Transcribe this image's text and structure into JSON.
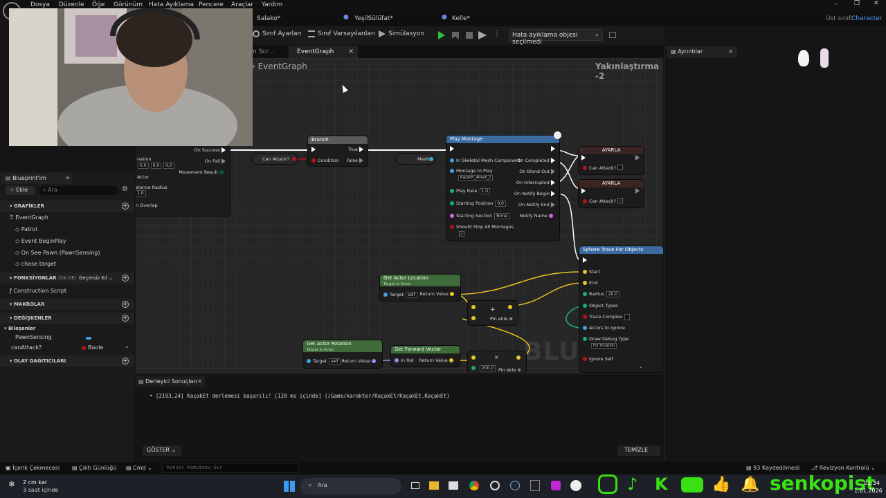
{
  "menu": [
    "Dosya",
    "Düzenle",
    "Öğe",
    "Görünüm",
    "Hata Ayıklama",
    "Pencere",
    "Araçlar",
    "Yardım"
  ],
  "top_tabs": [
    {
      "label": "Salako*",
      "color": "#e06d6d"
    },
    {
      "label": "YeşilSülüfat*",
      "color": "#6d86e0"
    },
    {
      "label": "Kelle*",
      "color": "#6d86e0"
    }
  ],
  "parent_class": {
    "label": "Üst sınıf:",
    "value": "Character"
  },
  "toolbar": {
    "class_settings": "Sınıf Ayarları",
    "class_defaults": "Sınıf Varsayılanları",
    "simulation": "Simülasyon",
    "debug_select": "Hata ayıklama objesi seçilmedi"
  },
  "graph_tabs": {
    "prev": "n Scr...",
    "active": "EventGraph"
  },
  "graph": {
    "breadcrumb": "EventGraph",
    "zoom": "Yakınlaştırma -2",
    "watermark": "BLUEPRINT"
  },
  "nodes": {
    "ai_move": {
      "on_success": "On Success",
      "on_fail": "On Fail",
      "movement_result": "Movement Result",
      "nation": "nation",
      "actor": "Actor",
      "radius_label": "stance Radius",
      "overlap": "n Overlap",
      "v0": "0,0",
      "v1": "0,0",
      "v2": "0,0",
      "v3": "1,0"
    },
    "branch": {
      "title": "Branch",
      "condition": "Condition",
      "true": "True",
      "false": "False"
    },
    "can_attack_get": "Can Attack?",
    "mesh_get": "Mesh",
    "play_montage": {
      "title": "Play Montage",
      "skeletal": "In Skeletal Mesh Component",
      "montage": "Montage to Play",
      "montage_value": "KaçakEt_Attack_2",
      "play_rate": "Play Rate",
      "play_rate_value": "1,0",
      "start_pos": "Starting Position",
      "start_pos_value": "0,0",
      "start_sec": "Starting Section",
      "start_sec_value": "None",
      "stop_all": "Should Stop All Montages",
      "on_completed": "On Completed",
      "on_blend_out": "On Blend Out",
      "on_interrupted": "On Interrupted",
      "on_notify_begin": "On Notify Begin",
      "on_notify_end": "On Notify End",
      "notify_name": "Notify Name"
    },
    "set1": {
      "title": "AYARLA",
      "pin": "Can Attack?"
    },
    "set2": {
      "title": "AYARLA",
      "pin": "Can Attack?"
    },
    "sphere": {
      "title": "Sphere Trace For Objects",
      "start": "Start",
      "end": "End",
      "radius": "Radius",
      "radius_value": "20,0",
      "object_types": "Object Types",
      "trace_complex": "Trace Complex",
      "actors_ignore": "Actors to Ignore",
      "draw_debug": "Draw Debug Type",
      "draw_debug_value": "For Duration",
      "ignore_self": "Ignore Self"
    },
    "get_location": {
      "title": "Get Actor Location",
      "sub": "Target is Actor",
      "target": "Target",
      "self": "self",
      "return": "Return Value"
    },
    "add1": {
      "add_pin": "Pin ekle"
    },
    "get_rotation": {
      "title": "Get Actor Rotation",
      "sub": "Target is Actor",
      "target": "Target",
      "self": "self",
      "return": "Return Value"
    },
    "forward": {
      "title": "Get Forward Vector",
      "in_rot": "In Rot",
      "return": "Return Value"
    },
    "mult": {
      "value": "200,0",
      "add_pin": "Pin ekle"
    }
  },
  "details": {
    "tab": "Ayrıntılar"
  },
  "left": {
    "title": "Blueprint'im",
    "add": "Ekle",
    "search_placeholder": "Ara",
    "graphs_header": "GRAFİKLER",
    "event_graph": "EventGraph",
    "events": [
      "Patrol",
      "Event BeginPlay",
      "On See Pawn (PawnSensing)",
      "chase target"
    ],
    "functions_header": "FONKSİYONLAR",
    "functions_count": "(34 GEÇERS",
    "override": "Geçersiz Kıl",
    "construction": "Construction Script",
    "macros_header": "MAKROLAR",
    "variables_header": "DEĞİŞKENLER",
    "components": "Bileşenler",
    "pawn_sensing": "PawnSensing",
    "can_attack_var": "canAttack?",
    "can_attack_type": "Boole",
    "dispatchers_header": "OLAY DAĞITICILARI"
  },
  "output": {
    "tab": "Derleyici Sonuçları",
    "message": "• [2193,24] KaçakEt derlemesi başarılı! [120 ms içinde] (/Game/karakter/KaçakEt/KaçakEt.KaçakEt)",
    "show": "GÖSTER",
    "clear": "TEMİZLE"
  },
  "status": {
    "content_drawer": "İçerik Çekmecesi",
    "output_log": "Çıktı Günlüğü",
    "cmd": "Cmd",
    "console_placeholder": "Konsol Komutunu Gir",
    "saved": "93 Kaydedilmedi",
    "revision": "Revizyon Kontrolü"
  },
  "taskbar": {
    "weather_temp": "2 cm kar",
    "weather_sub": "3 saat içinde",
    "search": "Ara",
    "time": "01:34",
    "date": "1.01.2026",
    "brand": "senkopist"
  }
}
